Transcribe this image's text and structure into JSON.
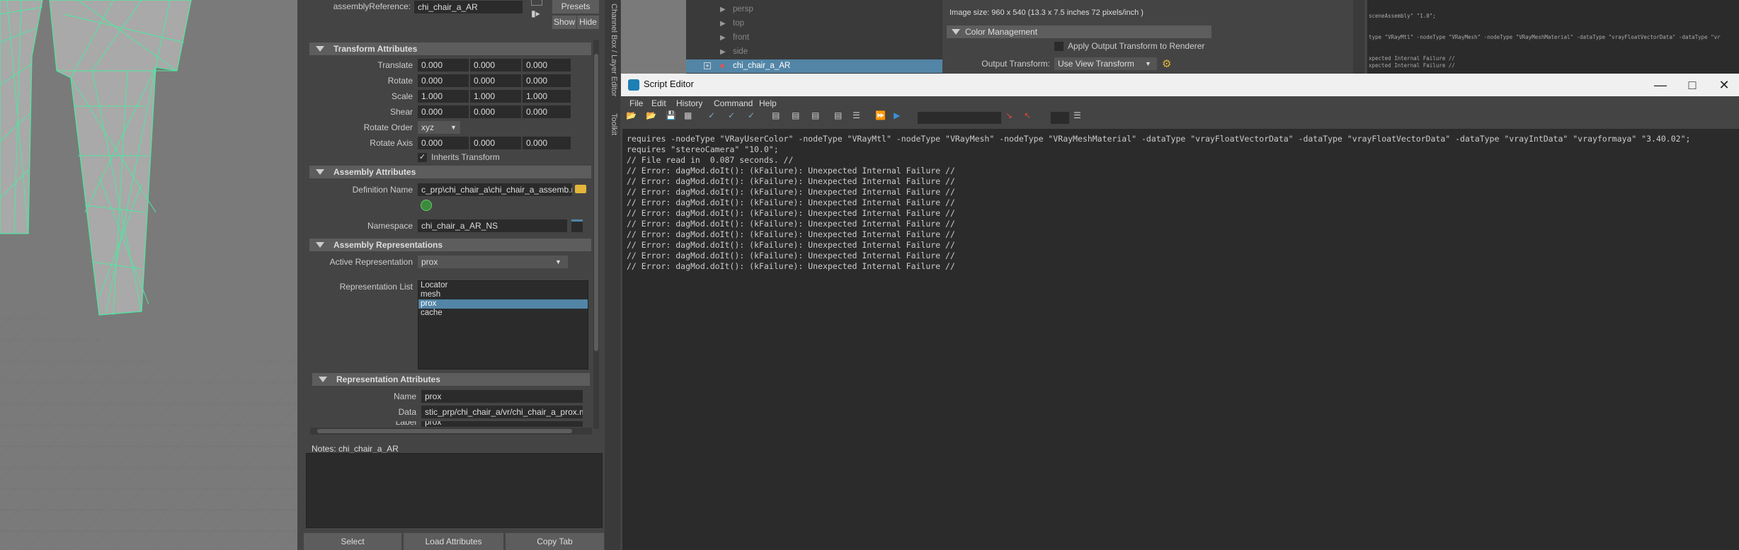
{
  "attribute_editor": {
    "assembly_reference_label": "assemblyReference:",
    "assembly_reference_value": "chi_chair_a_AR",
    "presets_label": "Presets",
    "show_label": "Show",
    "hide_label": "Hide",
    "side_tab_label": "Channel Box / Layer Editor",
    "side_tab2_label": "Toolkit",
    "sections": {
      "transform": "Transform Attributes",
      "assembly": "Assembly Attributes",
      "representations": "Assembly Representations",
      "rep_attributes": "Representation Attributes"
    },
    "transform": {
      "translate": {
        "label": "Translate",
        "values": [
          "0.000",
          "0.000",
          "0.000"
        ]
      },
      "rotate": {
        "label": "Rotate",
        "values": [
          "0.000",
          "0.000",
          "0.000"
        ]
      },
      "scale": {
        "label": "Scale",
        "values": [
          "1.000",
          "1.000",
          "1.000"
        ]
      },
      "shear": {
        "label": "Shear",
        "values": [
          "0.000",
          "0.000",
          "0.000"
        ]
      },
      "rotate_order_label": "Rotate Order",
      "rotate_order_value": "xyz",
      "rotate_axis": {
        "label": "Rotate Axis",
        "values": [
          "0.000",
          "0.000",
          "0.000"
        ]
      },
      "inherits_label": "Inherits Transform"
    },
    "assembly": {
      "definition_label": "Definition Name",
      "definition_value": "c_prp\\chi_chair_a\\chi_chair_a_assemb.mb",
      "namespace_label": "Namespace",
      "namespace_value": "chi_chair_a_AR_NS"
    },
    "representations": {
      "active_label": "Active Representation",
      "active_value": "prox",
      "list_label": "Representation List",
      "list_items": [
        "Locator",
        "mesh",
        "prox",
        "cache"
      ],
      "selected_index": 2
    },
    "rep_attributes": {
      "name_label": "Name",
      "name_value": "prox",
      "data_label": "Data",
      "data_value": "stic_prp/chi_chair_a/vr/chi_chair_a_prox.mb",
      "label_label": "Label",
      "label_value": "prox"
    },
    "notes_label": "Notes:",
    "notes_value": "chi_chair_a_AR",
    "footer": {
      "select": "Select",
      "load": "Load Attributes",
      "copy": "Copy Tab"
    }
  },
  "outliner": {
    "items": [
      "persp",
      "top",
      "front",
      "side",
      "chi_chair_a_AR"
    ]
  },
  "render_settings": {
    "image_size": "Image size: 960 x 540 (13.3 x 7.5 inches 72 pixels/inch )",
    "color_mgmt": "Color Management",
    "apply_output": "Apply Output Transform to Renderer",
    "output_label": "Output Transform:",
    "output_value": "Use View Transform"
  },
  "right_log": {
    "lines": [
      "sceneAssembly\" \"1.0\";",
      "",
      "",
      "type \"VRayMtl\" -nodeType \"VRayMesh\" -nodeType \"VRayMeshMaterial\" -dataType \"vrayFloatVectorData\" -dataType \"vr",
      "",
      "",
      "xpected Internal Failure //",
      "xpected Internal Failure //"
    ]
  },
  "script_editor": {
    "title": "Script Editor",
    "menu": [
      "File",
      "Edit",
      "History",
      "Command",
      "Help"
    ],
    "lines": [
      "requires -nodeType \"VRayUserColor\" -nodeType \"VRayMtl\" -nodeType \"VRayMesh\" -nodeType \"VRayMeshMaterial\" -dataType \"vrayFloatVectorData\" -dataType \"vrayFloatVectorData\" -dataType \"vrayIntData\" \"vrayformaya\" \"3.40.02\";",
      "requires \"stereoCamera\" \"10.0\";",
      "// File read in  0.087 seconds. //",
      "// Error: dagMod.doIt(): (kFailure): Unexpected Internal Failure //",
      "// Error: dagMod.doIt(): (kFailure): Unexpected Internal Failure //",
      "// Error: dagMod.doIt(): (kFailure): Unexpected Internal Failure //",
      "// Error: dagMod.doIt(): (kFailure): Unexpected Internal Failure //",
      "// Error: dagMod.doIt(): (kFailure): Unexpected Internal Failure //",
      "// Error: dagMod.doIt(): (kFailure): Unexpected Internal Failure //",
      "// Error: dagMod.doIt(): (kFailure): Unexpected Internal Failure //",
      "// Error: dagMod.doIt(): (kFailure): Unexpected Internal Failure //",
      "// Error: dagMod.doIt(): (kFailure): Unexpected Internal Failure //",
      "// Error: dagMod.doIt(): (kFailure): Unexpected Internal Failure //"
    ]
  },
  "colors": {
    "wireframe": "#4de8a0",
    "selection": "#5285a6",
    "panel": "#444444",
    "header": "#5d5d5d"
  }
}
